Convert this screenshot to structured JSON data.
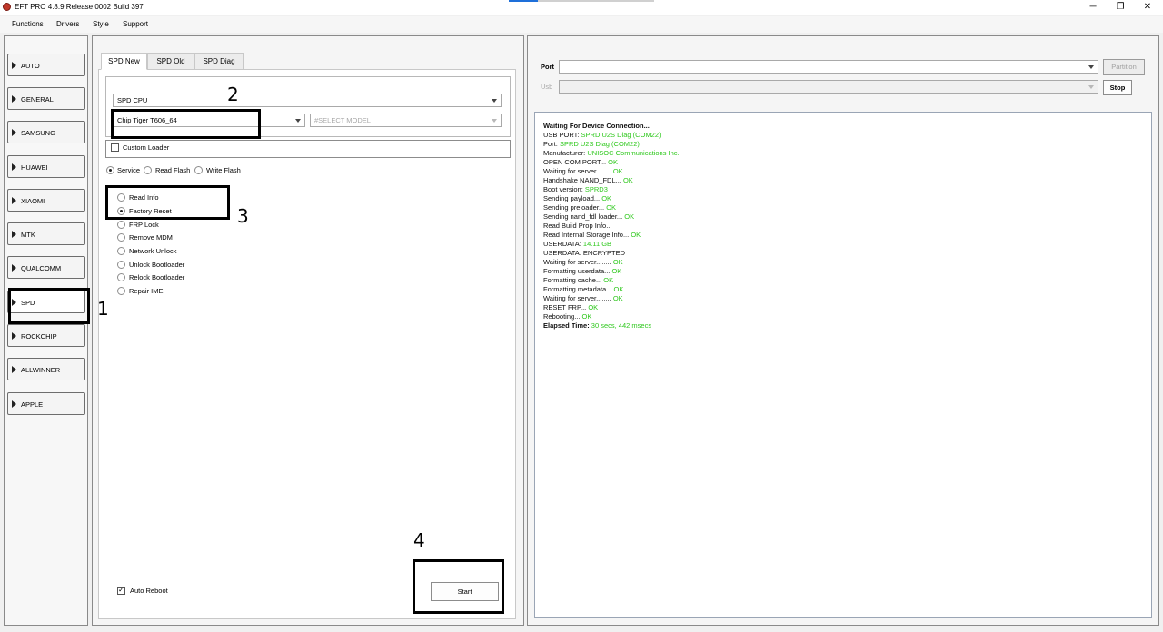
{
  "window": {
    "title": "EFT PRO 4.8.9 Release 0002 Build 397",
    "minimize": "─",
    "restore": "❐",
    "close": "✕"
  },
  "menu": [
    "Functions",
    "Drivers",
    "Style",
    "Support"
  ],
  "sidebar": {
    "items": [
      "AUTO",
      "GENERAL",
      "SAMSUNG",
      "HUAWEI",
      "XIAOMI",
      "MTK",
      "QUALCOMM",
      "SPD",
      "ROCKCHIP",
      "ALLWINNER",
      "APPLE"
    ],
    "active": "SPD"
  },
  "tabs": [
    "SPD New",
    "SPD Old",
    "SPD Diag"
  ],
  "form": {
    "cpu_select": "SPD CPU",
    "chip_select": "Chip Tiger T606_64",
    "model_select": "#SELECT MODEL",
    "custom_loader": "Custom Loader",
    "modes": [
      "Service",
      "Read Flash",
      "Write Flash"
    ],
    "selected_mode": "Service",
    "operations": [
      "Read Info",
      "Factory Reset",
      "FRP Lock",
      "Remove MDM",
      "Network Unlock",
      "Unlock Bootloader",
      "Relock Bootloader",
      "Repair IMEI"
    ],
    "selected_operation": "Factory Reset",
    "auto_reboot": "Auto Reboot",
    "auto_reboot_checked": true,
    "start_button": "Start"
  },
  "annotations": [
    "1",
    "2",
    "3",
    "4"
  ],
  "port": {
    "port_label": "Port",
    "usb_label": "Usb",
    "partition_button": "Partition",
    "stop_button": "Stop"
  },
  "log": [
    {
      "k": "Waiting For Device Connection...",
      "v": "",
      "bold": true
    },
    {
      "k": "USB PORT: ",
      "v": "SPRD U2S Diag (COM22)"
    },
    {
      "k": "Port: ",
      "v": "SPRD U2S Diag (COM22)"
    },
    {
      "k": "Manufacturer: ",
      "v": "UNISOC Communications Inc."
    },
    {
      "k": "OPEN COM PORT... ",
      "v": "OK"
    },
    {
      "k": "Waiting for server........ ",
      "v": "OK"
    },
    {
      "k": "Handshake NAND_FDL... ",
      "v": "OK"
    },
    {
      "k": "Boot version: ",
      "v": "SPRD3"
    },
    {
      "k": "Sending payload... ",
      "v": "OK"
    },
    {
      "k": "Sending preloader... ",
      "v": "OK"
    },
    {
      "k": "Sending nand_fdl loader... ",
      "v": "OK"
    },
    {
      "k": "Read Build Prop Info...",
      "v": ""
    },
    {
      "k": "Read Internal Storage Info... ",
      "v": "OK"
    },
    {
      "k": "USERDATA: ",
      "v": "14.11 GB"
    },
    {
      "k": "USERDATA: ENCRYPTED",
      "v": ""
    },
    {
      "k": "Waiting for server........ ",
      "v": "OK"
    },
    {
      "k": "Formatting userdata... ",
      "v": "OK"
    },
    {
      "k": "Formatting cache... ",
      "v": "OK"
    },
    {
      "k": "Formatting metadata... ",
      "v": "OK"
    },
    {
      "k": "Waiting for server........ ",
      "v": "OK"
    },
    {
      "k": "RESET FRP... ",
      "v": "OK"
    },
    {
      "k": "Rebooting... ",
      "v": "OK"
    },
    {
      "k": "Elapsed Time: ",
      "v": "30 secs, 442 msecs",
      "bold": true
    }
  ]
}
